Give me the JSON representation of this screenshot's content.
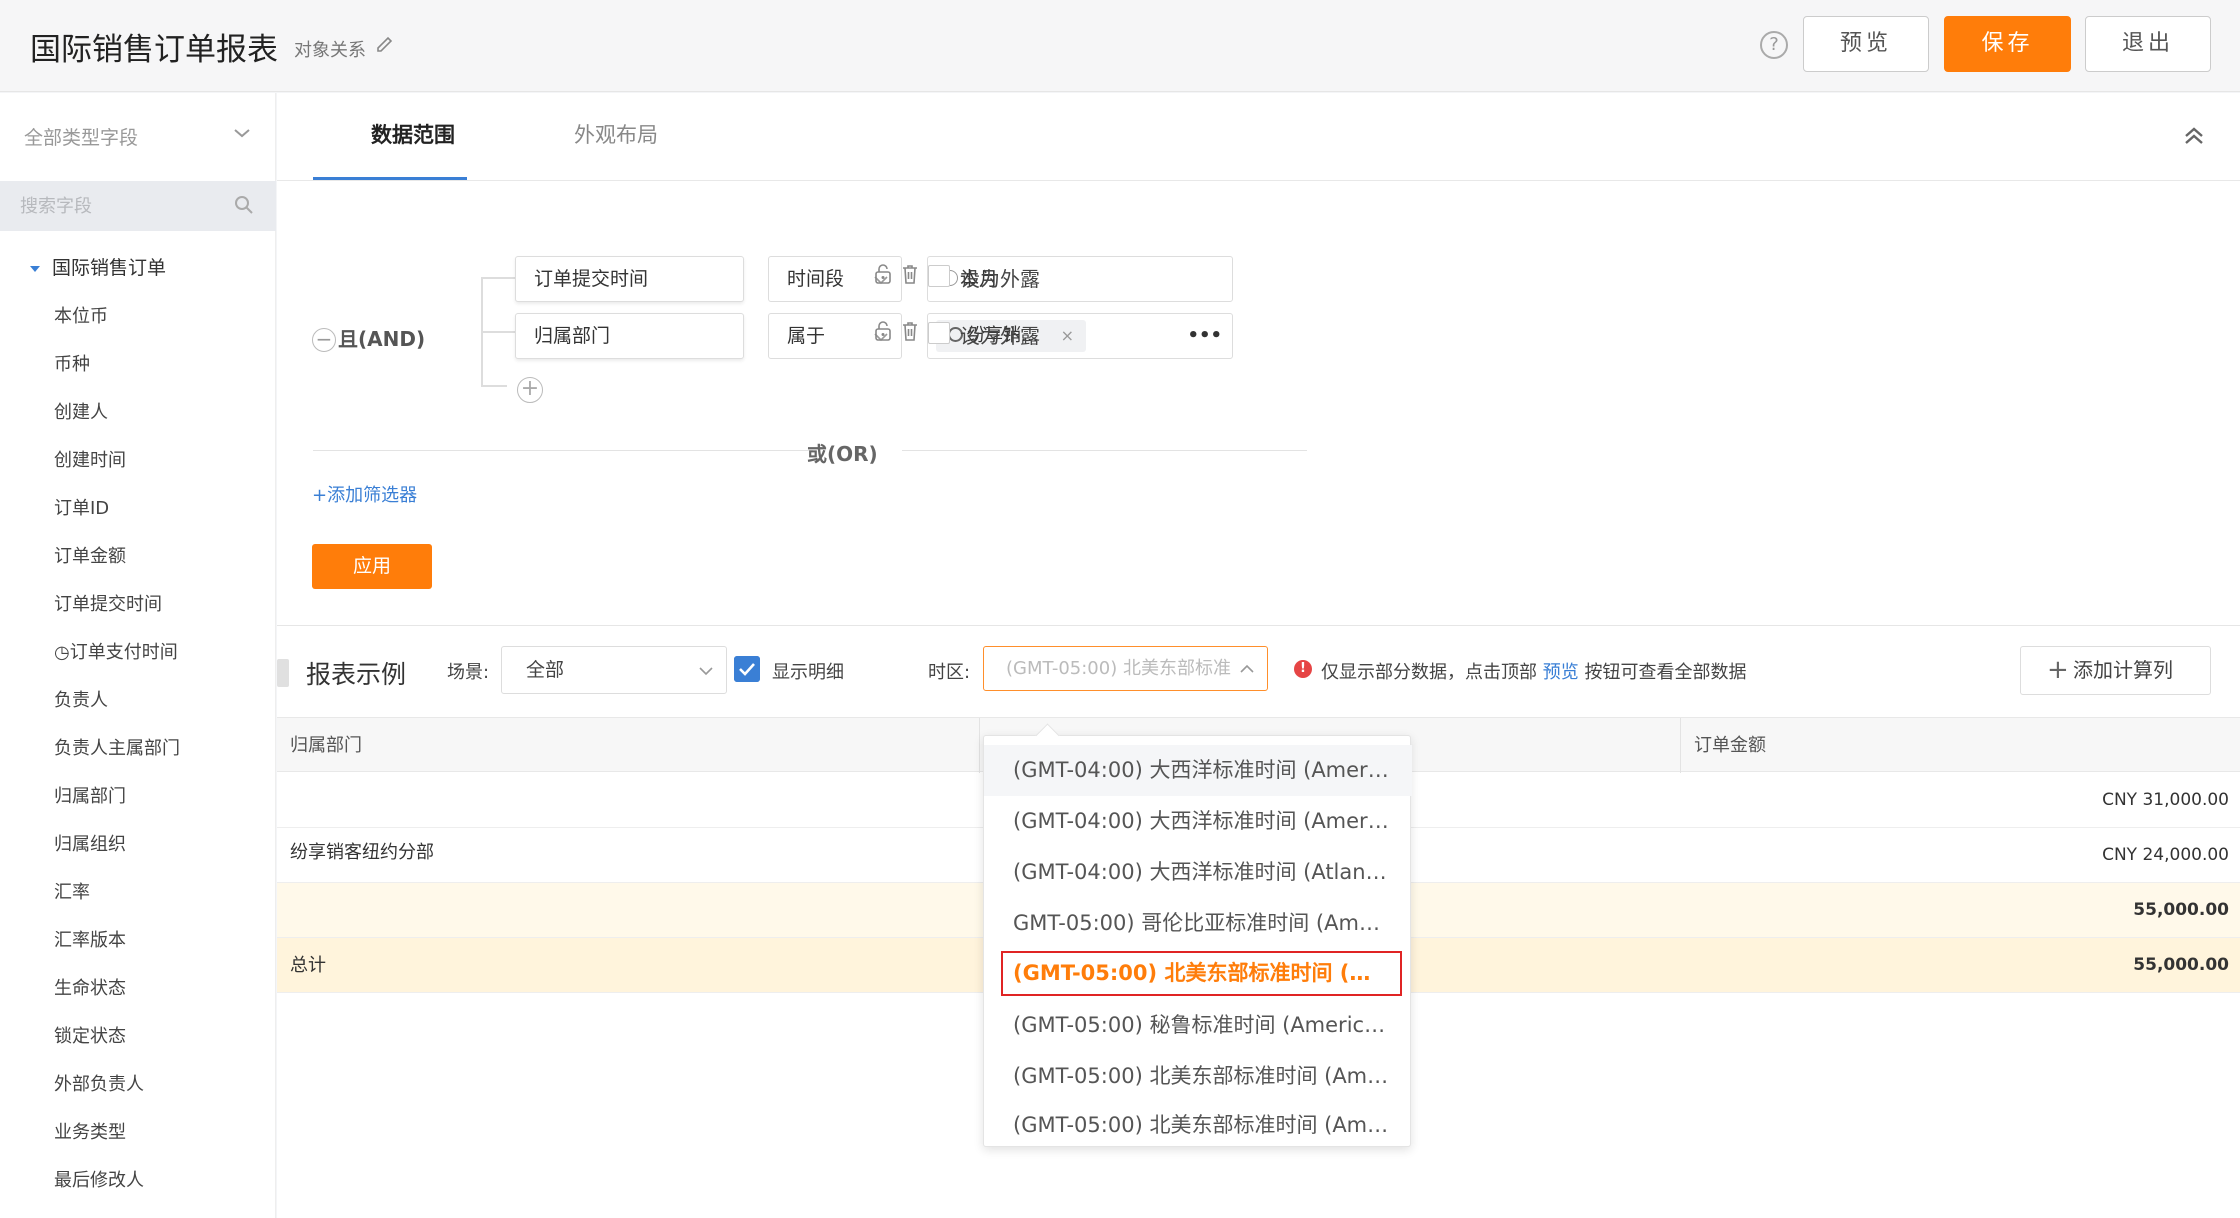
{
  "header": {
    "title": "国际销售订单报表",
    "object_relation": "对象关系",
    "help": "?",
    "preview_label": "预览",
    "save_label": "保存",
    "exit_label": "退出"
  },
  "sidebar": {
    "type_select": "全部类型字段",
    "search_placeholder": "搜索字段",
    "group_label": "国际销售订单",
    "fields": [
      "本位币",
      "币种",
      "创建人",
      "创建时间",
      "订单ID",
      "订单金额",
      "订单提交时间",
      "◷订单支付时间",
      "负责人",
      "负责人主属部门",
      "归属部门",
      "归属组织",
      "汇率",
      "汇率版本",
      "生命状态",
      "锁定状态",
      "外部负责人",
      "业务类型",
      "最后修改人"
    ]
  },
  "tabs": [
    {
      "label": "数据范围",
      "active": true
    },
    {
      "label": "外观布局",
      "active": false
    }
  ],
  "filters": {
    "and_label": "且(AND)",
    "rows": [
      {
        "field": "订单提交时间",
        "operator": "时间段",
        "value": "本月",
        "expose_label": "设为外露"
      },
      {
        "field": "归属部门",
        "operator": "属于",
        "value_chip": "纷享销...",
        "more": "•••",
        "expose_label": "设为外露"
      }
    ],
    "or_label": "或(OR)",
    "add_filter": "+添加筛选器",
    "apply_label": "应用"
  },
  "report": {
    "title": "报表示例",
    "scene_label": "场景:",
    "scene_value": "全部",
    "show_detail_label": "显示明细",
    "show_detail_checked": true,
    "timezone_label": "时区:",
    "timezone_value": "(GMT-05:00) 北美东部标准",
    "warning_prefix": "仅显示部分数据，点击顶部",
    "warning_link": "预览",
    "warning_suffix": "按钮可查看全部数据",
    "add_calc_label": "添加计算列",
    "columns": [
      "归属部门",
      "",
      "订单金额"
    ],
    "dept": "纷享销客纽约分部",
    "rows": [
      {
        "amount": "CNY 31,000.00"
      },
      {
        "amount": "CNY 24,000.00"
      },
      {
        "amount": "55,000.00",
        "subtotal": true
      }
    ],
    "total_label": "总计",
    "total_amount": "55,000.00"
  },
  "timezone_options": [
    "(GMT-04:00) 大西洋标准时间 (America/...",
    "(GMT-04:00) 大西洋标准时间 (America/...",
    "(GMT-04:00) 大西洋标准时间 (Atlantic/...",
    "GMT-05:00) 哥伦比亚标准时间 (America/...",
    "(GMT-05:00) 北美东部标准时间 (America/...",
    "(GMT-05:00) 秘鲁标准时间 (America/...",
    "(GMT-05:00) 北美东部标准时间 (America/...",
    "(GMT-05:00) 北美东部标准时间 (America/..."
  ],
  "timezone_selected_index": 4,
  "colors": {
    "accent": "#ff7d0a",
    "link": "#3a7fd5",
    "selection_border": "#e02424"
  }
}
